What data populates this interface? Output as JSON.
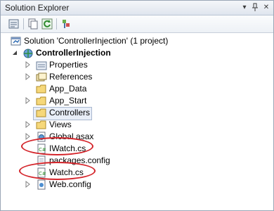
{
  "window": {
    "title": "Solution Explorer",
    "buttons": [
      "▾",
      "📌",
      "✕"
    ]
  },
  "toolbar": {
    "icons": [
      "properties-icon",
      "show-all-files-icon",
      "refresh-icon",
      "view-class-diagram-icon"
    ]
  },
  "tree": {
    "solution": "Solution 'ControllerInjection' (1 project)",
    "project": "ControllerInjection",
    "items": [
      {
        "label": "Properties",
        "icon": "properties-folder-icon",
        "expandable": true
      },
      {
        "label": "References",
        "icon": "references-icon",
        "expandable": true
      },
      {
        "label": "App_Data",
        "icon": "folder-icon",
        "expandable": false
      },
      {
        "label": "App_Start",
        "icon": "folder-icon",
        "expandable": true
      },
      {
        "label": "Controllers",
        "icon": "folder-icon",
        "expandable": false,
        "selected": true
      },
      {
        "label": "Views",
        "icon": "folder-icon",
        "expandable": true
      },
      {
        "label": "Global.asax",
        "icon": "asax-file-icon",
        "expandable": true
      },
      {
        "label": "IWatch.cs",
        "icon": "cs-file-icon",
        "expandable": false,
        "highlighted": true
      },
      {
        "label": "packages.config",
        "icon": "config-file-icon",
        "expandable": false
      },
      {
        "label": "Watch.cs",
        "icon": "cs-file-icon",
        "expandable": false,
        "highlighted": true
      },
      {
        "label": "Web.config",
        "icon": "config-file-icon",
        "expandable": true
      }
    ]
  },
  "colors": {
    "highlight_ring": "#d4252b",
    "selection": "#e8eef8"
  }
}
